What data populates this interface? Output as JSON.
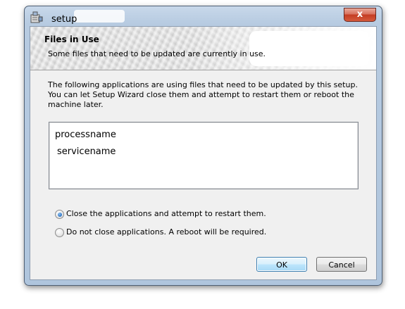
{
  "window": {
    "title": "setup",
    "close_glyph": "x"
  },
  "banner": {
    "title": "Files in Use",
    "subtitle": "Some files that need to be updated are currently in use."
  },
  "description": "The following applications are using files that need to be updated by this setup. You can let Setup Wizard close them and attempt to restart them or reboot the machine later.",
  "list": {
    "items": [
      "processname",
      "servicename"
    ]
  },
  "options": [
    {
      "label": "Close the applications and attempt to restart them.",
      "checked": true
    },
    {
      "label": "Do not close applications. A reboot will be required.",
      "checked": false
    }
  ],
  "buttons": {
    "ok": "OK",
    "cancel": "Cancel"
  },
  "colors": {
    "accent": "#3c7fb1",
    "close_button": "#c43c23"
  },
  "icons": {
    "app": "installer-icon",
    "close": "close-icon"
  }
}
